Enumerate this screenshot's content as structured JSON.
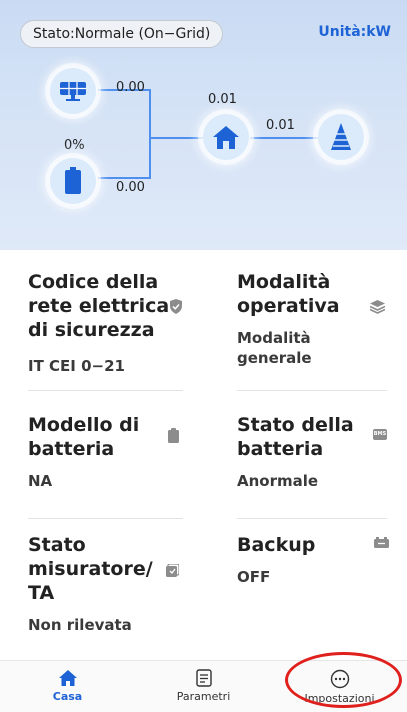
{
  "header": {
    "status": "Stato:Normale (On−Grid)",
    "unit": "Unità:kW"
  },
  "flow": {
    "pv_power": "0.00",
    "battery_soc": "0%",
    "battery_power": "0.00",
    "home_power": "0.01",
    "grid_power": "0.01"
  },
  "info": {
    "grid_code": {
      "title_lines": [
        "Codice della",
        "rete elettrica",
        "di sicurezza"
      ],
      "value": "IT CEI 0−21"
    },
    "mode": {
      "title_lines": [
        "Modalità",
        "operativa"
      ],
      "value_lines": [
        "Modalità",
        "generale"
      ]
    },
    "battery_model": {
      "title_lines": [
        "Modello di",
        "batteria"
      ],
      "value": "NA"
    },
    "battery_state": {
      "title_lines": [
        "Stato della",
        "batteria"
      ],
      "value": "Anormale",
      "icon_text": "BMS"
    },
    "meter": {
      "title_lines": [
        "Stato",
        "misuratore/",
        "TA"
      ],
      "value": "Non rilevata"
    },
    "backup": {
      "title_lines": [
        "Backup"
      ],
      "value": "OFF"
    }
  },
  "nav": {
    "home": "Casa",
    "params": "Parametri",
    "settings": "Impostazioni"
  },
  "colors": {
    "accent": "#1e63d6",
    "highlight": "#e0201d"
  }
}
